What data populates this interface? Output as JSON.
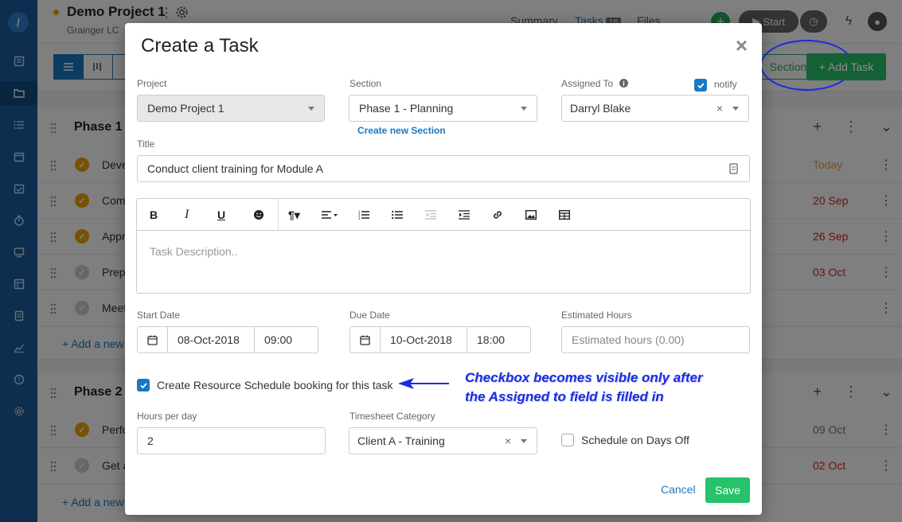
{
  "app": {
    "logo_text": "/",
    "project_title": "Demo Project 1",
    "project_org": "Grainger LC",
    "nav_tabs": [
      {
        "label": "Summary"
      },
      {
        "label": "Tasks",
        "count": "16"
      },
      {
        "label": "Files"
      }
    ],
    "start_label": "Start",
    "add_section_label": "Section",
    "add_task_label": "+ Add Task",
    "sections": [
      {
        "name": "Phase 1 -",
        "tasks": [
          {
            "name": "Deve",
            "date": "Today",
            "date_color": "#e6a23c",
            "status": "done"
          },
          {
            "name": "Com",
            "date": "20 Sep",
            "date_color": "#e02020",
            "status": "done"
          },
          {
            "name": "Appr",
            "date": "26 Sep",
            "date_color": "#e02020",
            "status": "done"
          },
          {
            "name": "Prep",
            "date": "03 Oct",
            "date_color": "#e02020",
            "status": "open"
          },
          {
            "name": "Meet",
            "date": "",
            "date_color": "#555555",
            "status": "open"
          }
        ],
        "add_new": "+ Add a new"
      },
      {
        "name": "Phase 2 -",
        "tasks": [
          {
            "name": "Perfo",
            "date": "09 Oct",
            "date_color": "#777777",
            "status": "done"
          },
          {
            "name": "Get a",
            "date": "02 Oct",
            "date_color": "#e02020",
            "status": "open"
          }
        ],
        "add_new": "+ Add a new"
      }
    ]
  },
  "modal": {
    "title": "Create a Task",
    "close": "×",
    "project": {
      "label": "Project",
      "value": "Demo Project 1"
    },
    "section": {
      "label": "Section",
      "value": "Phase 1 - Planning",
      "create_link": "Create new Section"
    },
    "assigned": {
      "label": "Assigned To",
      "info": "i",
      "value": "Darryl Blake",
      "clear": "×",
      "notify_label": "notify",
      "notify_checked": true
    },
    "title_field": {
      "label": "Title",
      "value": "Conduct client training for Module A"
    },
    "editor": {
      "placeholder": "Task Description..",
      "tools": [
        "bold-icon",
        "italic-icon",
        "underline-icon",
        "emoji-icon",
        "paragraph-icon",
        "align-icon",
        "ordered-list-icon",
        "unordered-list-icon",
        "outdent-icon",
        "indent-icon",
        "link-icon",
        "image-icon",
        "table-icon"
      ]
    },
    "start_date": {
      "label": "Start Date",
      "date": "08-Oct-2018",
      "time": "09:00"
    },
    "due_date": {
      "label": "Due Date",
      "date": "10-Oct-2018",
      "time": "18:00"
    },
    "estimated": {
      "label": "Estimated Hours",
      "placeholder": "Estimated hours (0.00)"
    },
    "resource_booking": {
      "label": "Create Resource Schedule booking for this task",
      "checked": true
    },
    "hours_per_day": {
      "label": "Hours per day",
      "value": "2"
    },
    "timesheet": {
      "label": "Timesheet Category",
      "value": "Client A - Training",
      "clear": "×"
    },
    "days_off": {
      "label": "Schedule on Days Off",
      "checked": false
    },
    "cancel_label": "Cancel",
    "save_label": "Save"
  },
  "annotation": {
    "line1": "Checkbox becomes visible only after",
    "line2": "the Assigned to field is filled in",
    "color": "#1a2ce0"
  }
}
